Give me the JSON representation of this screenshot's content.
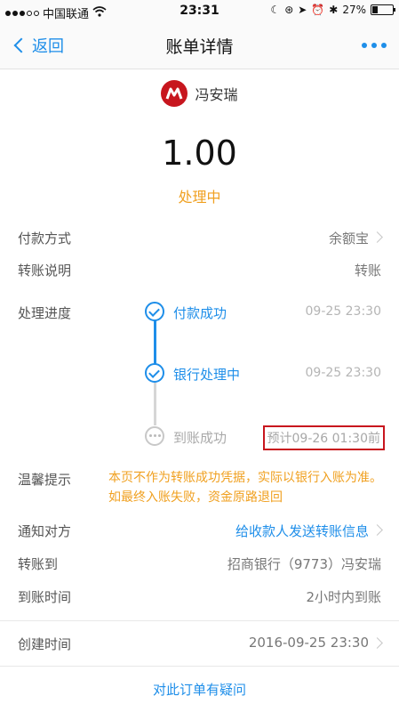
{
  "status_bar": {
    "carrier": "中国联通",
    "time": "23:31",
    "battery": "27%",
    "battery_fraction": 0.27
  },
  "nav": {
    "back_label": "返回",
    "title": "账单详情"
  },
  "merchant": {
    "name": "冯安瑞"
  },
  "amount": "1.00",
  "status": "处理中",
  "rows": {
    "payment_method": {
      "label": "付款方式",
      "value": "余额宝"
    },
    "transfer_note": {
      "label": "转账说明",
      "value": "转账"
    },
    "progress": {
      "label": "处理进度"
    },
    "tip": {
      "label": "温馨提示",
      "value": "本页不作为转账成功凭据，实际以银行入账为准。如最终入账失败，资金原路退回"
    },
    "notify": {
      "label": "通知对方",
      "value": "给收款人发送转账信息"
    },
    "transfer_to": {
      "label": "转账到",
      "value": "招商银行（9773）冯安瑞"
    },
    "arrival_time": {
      "label": "到账时间",
      "value": "2小时内到账"
    },
    "created_time": {
      "label": "创建时间",
      "value": "2016-09-25 23:30"
    }
  },
  "progress_steps": [
    {
      "label": "付款成功",
      "time": "09-25 23:30",
      "state": "done"
    },
    {
      "label": "银行处理中",
      "time": "09-25 23:30",
      "state": "done"
    },
    {
      "label": "到账成功",
      "time": "预计09-26 01:30前",
      "state": "pending"
    }
  ],
  "footer": {
    "question_link": "对此订单有疑问"
  },
  "colors": {
    "accent": "#1e8ee9",
    "warning": "#f0a020",
    "highlight_box": "#c8161e",
    "logo": "#c7161e"
  }
}
